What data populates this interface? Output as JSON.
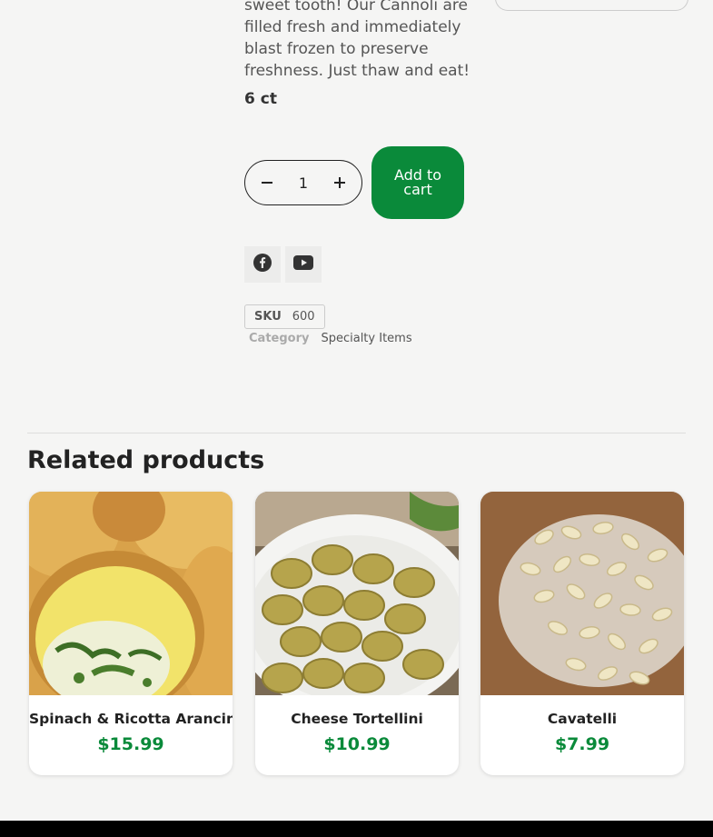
{
  "product": {
    "description": "sweet tooth! Our Cannoli are filled fresh and immediately blast frozen to preserve freshness. Just thaw and eat!",
    "count": "6 ct",
    "quantity": "1",
    "add_to_cart": "Add to cart",
    "sku_label": "SKU",
    "sku_value": "600",
    "category_label": "Category",
    "category_value": "Specialty Items"
  },
  "social": [
    {
      "icon": "facebook-icon"
    },
    {
      "icon": "youtube-icon"
    }
  ],
  "related": {
    "title": "Related products",
    "items": [
      {
        "name": "Spinach & Ricotta Arancini",
        "price": "$15.99"
      },
      {
        "name": "Cheese Tortellini",
        "price": "$10.99"
      },
      {
        "name": "Cavatelli",
        "price": "$7.99"
      }
    ]
  },
  "colors": {
    "accent": "#0a8a3a",
    "background": "#f5f5f4",
    "footer": "#000000"
  }
}
